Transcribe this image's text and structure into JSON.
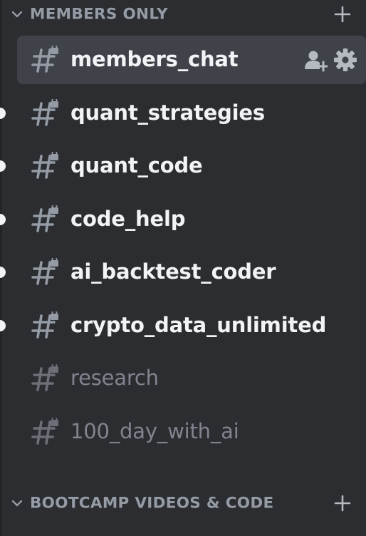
{
  "categories": [
    {
      "label": "MEMBERS ONLY",
      "chevron_icon": "chevron-down-icon",
      "add_icon": "plus-icon"
    },
    {
      "label": "BOOTCAMP VIDEOS & CODE",
      "chevron_icon": "chevron-down-icon",
      "add_icon": "plus-icon"
    }
  ],
  "channels": [
    {
      "name": "members_chat",
      "state": "selected",
      "icon": "locked-hash-icon",
      "actions": [
        "add-member-icon",
        "gear-icon"
      ]
    },
    {
      "name": "quant_strategies",
      "state": "unread",
      "icon": "locked-hash-icon"
    },
    {
      "name": "quant_code",
      "state": "unread",
      "icon": "locked-hash-icon"
    },
    {
      "name": "code_help",
      "state": "unread",
      "icon": "locked-hash-icon"
    },
    {
      "name": "ai_backtest_coder",
      "state": "unread",
      "icon": "locked-hash-icon"
    },
    {
      "name": "crypto_data_unlimited",
      "state": "unread",
      "icon": "locked-hash-icon"
    },
    {
      "name": "research",
      "state": "muted",
      "icon": "locked-hash-icon"
    },
    {
      "name": "100_day_with_ai",
      "state": "muted",
      "icon": "locked-hash-icon"
    }
  ],
  "colors": {
    "background": "#2b2d31",
    "selected_bg": "#404249",
    "text_bright": "#f2f3f5",
    "text_muted": "#80848e",
    "category_text": "#949ba4"
  }
}
